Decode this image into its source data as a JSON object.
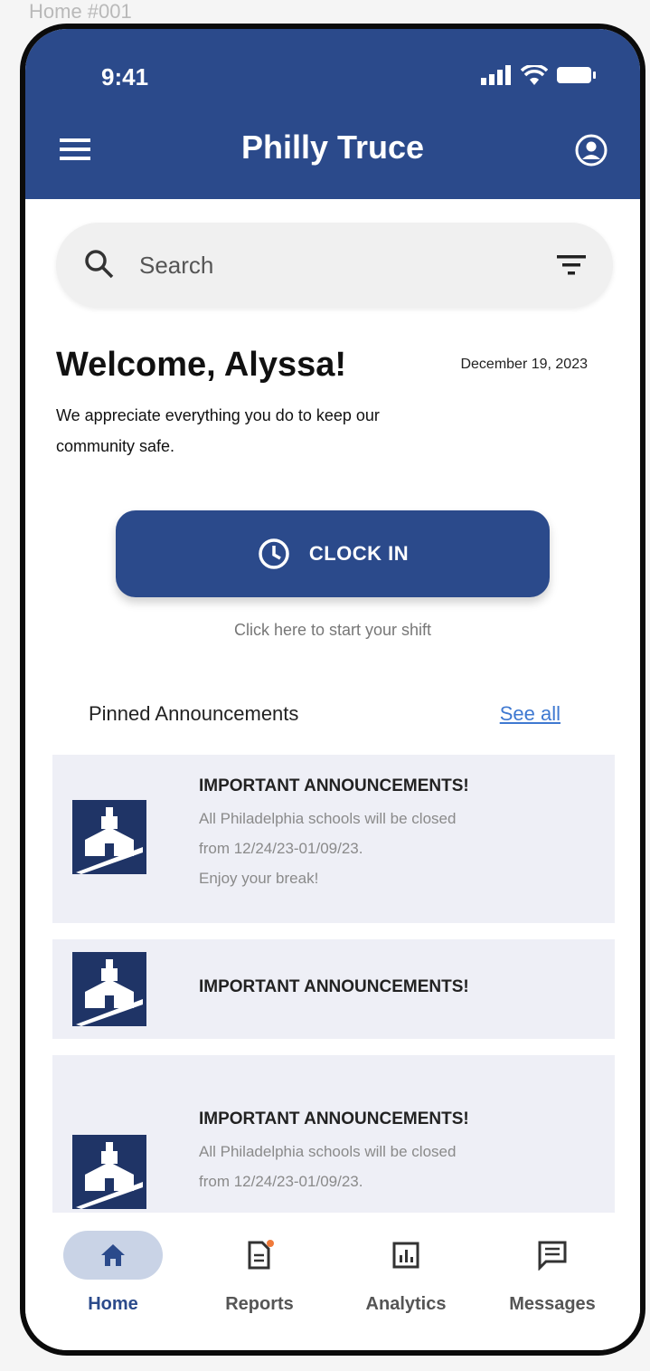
{
  "frame_label": "Home #001",
  "status_bar": {
    "time": "9:41"
  },
  "app_bar": {
    "title": "Philly Truce"
  },
  "search": {
    "placeholder": "Search"
  },
  "welcome": {
    "greeting": "Welcome, Alyssa!",
    "date": "December 19, 2023",
    "message": "We appreciate everything you do to keep our community safe."
  },
  "clock_in": {
    "label": "CLOCK IN",
    "hint": "Click here to start your shift"
  },
  "announcements": {
    "section_title": "Pinned Announcements",
    "see_all": "See all",
    "items": [
      {
        "heading": "IMPORTANT ANNOUNCEMENTS!",
        "line1": "All Philadelphia schools will be closed",
        "line2": "from 12/24/23-01/09/23.",
        "line3": "Enjoy your break!"
      },
      {
        "heading": "IMPORTANT ANNOUNCEMENTS!"
      },
      {
        "heading": "IMPORTANT ANNOUNCEMENTS!",
        "line1": "All Philadelphia schools will be closed",
        "line2": "from 12/24/23-01/09/23."
      }
    ]
  },
  "bottom_nav": {
    "items": [
      {
        "label": "Home",
        "icon": "home-icon",
        "active": true
      },
      {
        "label": "Reports",
        "icon": "report-icon",
        "badge": true
      },
      {
        "label": "Analytics",
        "icon": "analytics-icon"
      },
      {
        "label": "Messages",
        "icon": "message-icon"
      }
    ]
  },
  "colors": {
    "primary": "#2b4a8b",
    "card_bg": "#eeeff6",
    "link": "#3f79d1",
    "nav_active_pill": "#c9d3e6",
    "badge": "#f07a3a"
  }
}
